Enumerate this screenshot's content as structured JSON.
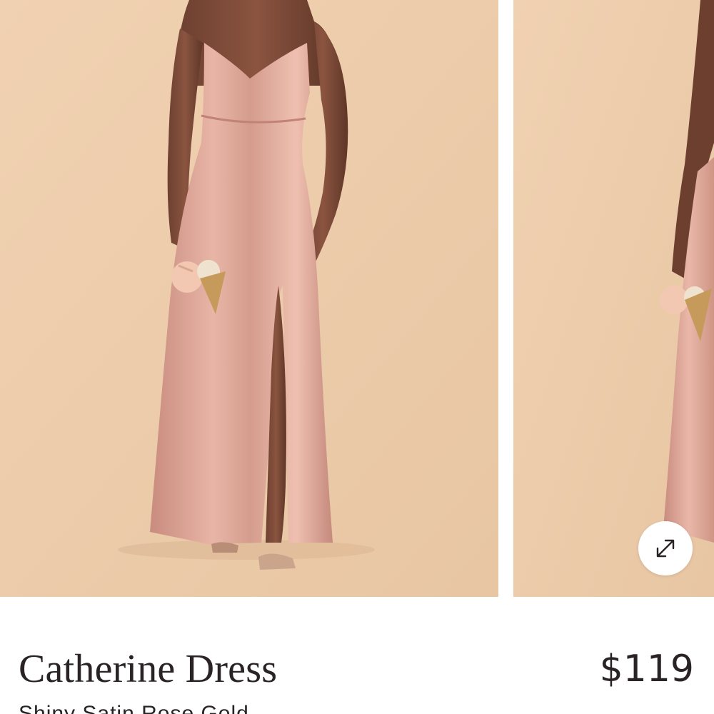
{
  "product": {
    "name": "Catherine Dress",
    "price": "$119",
    "variant": "Shiny Satin Rose Gold"
  },
  "gallery": {
    "images": [
      {
        "alt": "Catherine Dress in Shiny Satin Rose Gold, front view"
      },
      {
        "alt": "Catherine Dress in Shiny Satin Rose Gold, side view"
      }
    ],
    "expand_icon": "expand-arrows-icon"
  },
  "colors": {
    "background": "#ecccab",
    "dress": "#d9a294",
    "text": "#2a2326"
  }
}
